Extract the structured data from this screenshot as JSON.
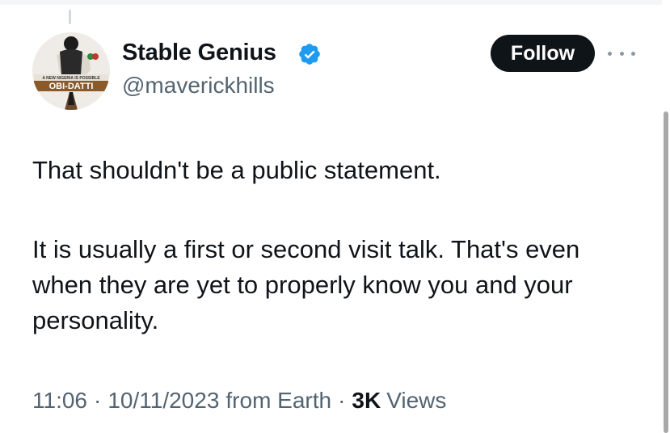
{
  "author": {
    "display_name": "Stable Genius",
    "handle": "@maverickhills",
    "verified": true,
    "avatar_caption_small": "A NEW NIGERIA IS POSSIBLE",
    "avatar_caption_large": "OBI-DATTI"
  },
  "actions": {
    "follow_label": "Follow"
  },
  "tweet": {
    "paragraph_1": "That shouldn't be a public statement.",
    "paragraph_2": "It is usually a first or second visit talk. That's even when they are yet to properly know you and your personality."
  },
  "meta": {
    "time": "11:06",
    "date": "10/11/2023",
    "source": "from Earth",
    "separator": "·",
    "views_count": "3K",
    "views_label": "Views"
  },
  "colors": {
    "verified_blue": "#1d9bf0",
    "follow_bg": "#0f1419",
    "secondary_text": "#536471"
  }
}
